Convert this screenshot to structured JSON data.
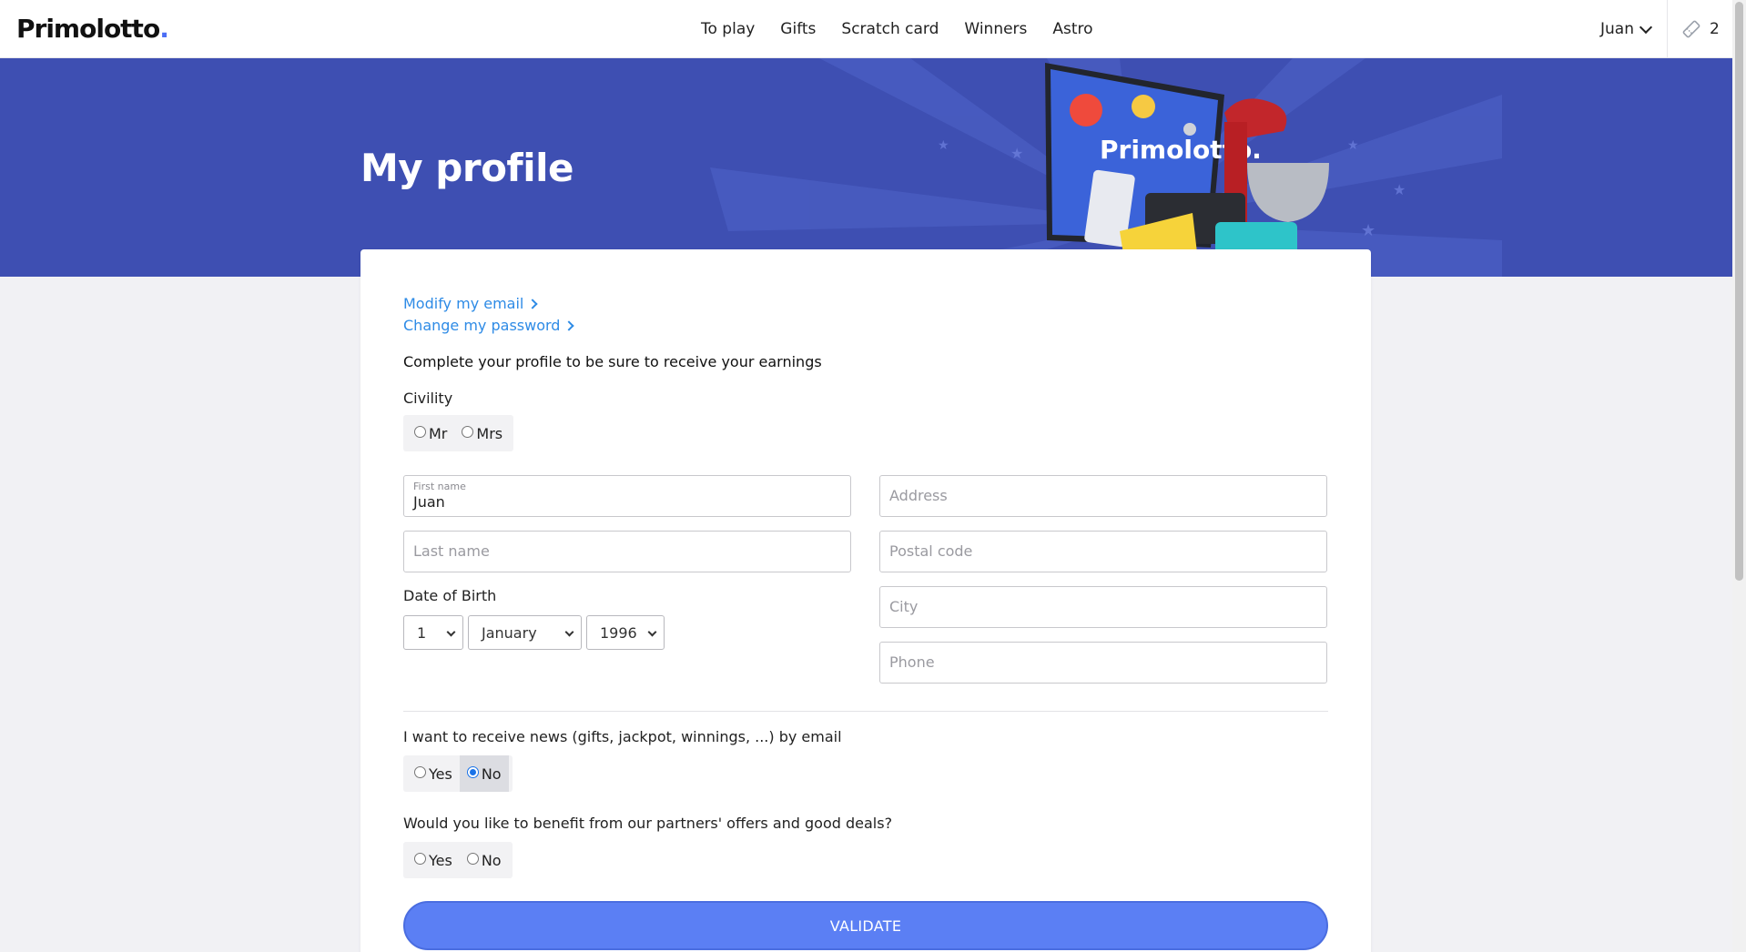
{
  "header": {
    "logo_text": "Primolotto",
    "logo_dot": ".",
    "nav": [
      "To play",
      "Gifts",
      "Scratch card",
      "Winners",
      "Astro"
    ],
    "user_name": "Juan",
    "tickets_count": "2"
  },
  "hero": {
    "title": "My profile",
    "image_brand_text": "Primolotto."
  },
  "links": {
    "modify_email": "Modify my email",
    "change_password": "Change my password"
  },
  "form": {
    "intro": "Complete your profile to be sure to receive your earnings",
    "civility_label": "Civility",
    "civility_options": [
      "Mr",
      "Mrs"
    ],
    "first_name_label": "First name",
    "first_name_value": "Juan",
    "last_name_placeholder": "Last name",
    "address_placeholder": "Address",
    "postal_code_placeholder": "Postal code",
    "city_placeholder": "City",
    "phone_placeholder": "Phone",
    "dob_label": "Date of Birth",
    "dob_day": "1",
    "dob_month": "January",
    "dob_year": "1996",
    "news_question": "I want to receive news (gifts, jackpot, winnings, ...) by email",
    "news_yes": "Yes",
    "news_no": "No",
    "news_selected": "No",
    "partners_question": "Would you like to benefit from our partners' offers and good deals?",
    "partners_yes": "Yes",
    "partners_no": "No",
    "validate_label": "VALIDATE"
  },
  "colors": {
    "hero_bg": "#3e4fb2",
    "accent_blue": "#5b7ff4",
    "link_blue": "#2e8be6"
  }
}
